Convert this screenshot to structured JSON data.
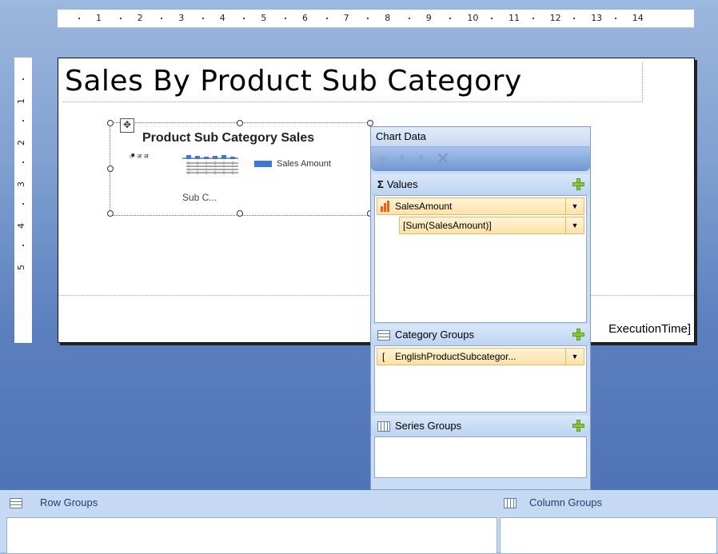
{
  "ruler": {
    "top_numbers": [
      "1",
      "2",
      "3",
      "4",
      "5",
      "6",
      "7",
      "8",
      "9",
      "10",
      "11",
      "12",
      "13",
      "14"
    ],
    "left_numbers": [
      "1",
      "2",
      "3",
      "4",
      "5"
    ]
  },
  "report": {
    "title": "Sales By Product Sub Category",
    "footer_text": "ExecutionTime]"
  },
  "chart": {
    "title": "Product Sub Category Sales",
    "legend_label": "Sales Amount",
    "axis_label": "Sub C...",
    "accent_color": "#3d78d8"
  },
  "chart_data_panel": {
    "header": "Chart Data",
    "values_label": "Values",
    "values_icon": "sigma-icon",
    "value_field": "SalesAmount",
    "value_expression": "[Sum(SalesAmount)]",
    "category_groups_label": "Category Groups",
    "category_field": "EnglishProductSubcategor...",
    "series_groups_label": "Series Groups"
  },
  "bottom": {
    "row_groups": "Row Groups",
    "column_groups": "Column Groups"
  }
}
